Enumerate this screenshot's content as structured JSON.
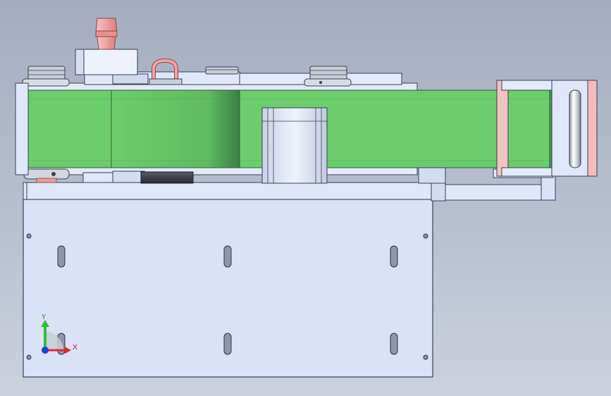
{
  "viewport": {
    "background_top": "#a4adbe",
    "background_bottom": "#cbd1dc"
  },
  "triad": {
    "y_label": "Y",
    "x_label": "X",
    "y_color": "#2fbf3a",
    "x_color": "#e02a2a",
    "z_color": "#1f3fd6"
  },
  "colors": {
    "belt": "#6bcd6b",
    "belt_shade": "#3f8f4a",
    "plate": "#d9e2f6",
    "edge": "#3a3f52",
    "accent_pink": "#f2a2a2"
  }
}
